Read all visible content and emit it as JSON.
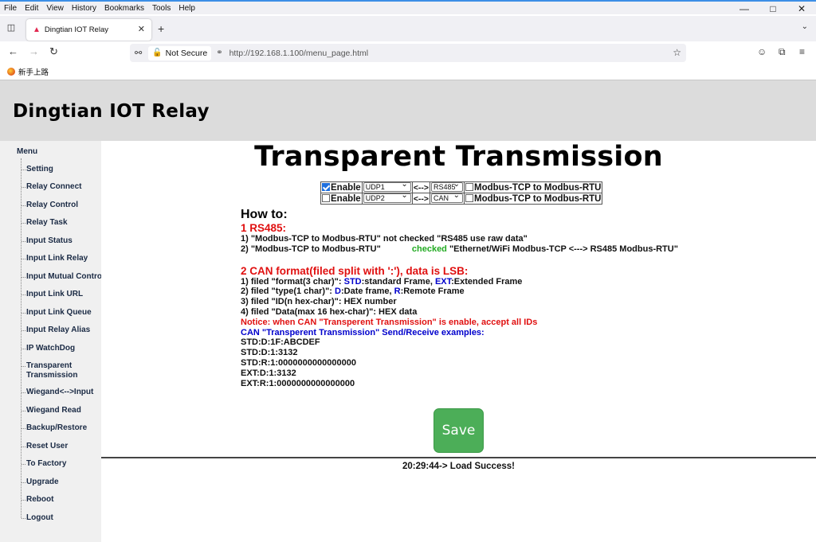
{
  "browser": {
    "menu": [
      "File",
      "Edit",
      "View",
      "History",
      "Bookmarks",
      "Tools",
      "Help"
    ],
    "tab_title": "Dingtian IOT Relay",
    "security_label": "Not Secure",
    "url": "http://192.168.1.100/menu_page.html",
    "bookmark": "新手上路"
  },
  "page": {
    "header_title": "Dingtian IOT Relay",
    "menu_title": "Menu",
    "sidebar": [
      "Setting",
      "Relay Connect",
      "Relay Control",
      "Relay Task",
      "Input Status",
      "Input Link Relay",
      "Input Mutual Control",
      "Input Link URL",
      "Input Link Queue",
      "Input Relay Alias",
      "IP WatchDog",
      "Transparent Transmission",
      "Wiegand<-->Input",
      "Wiegand Read",
      "Backup/Restore",
      "Reset User",
      "To Factory",
      "Upgrade",
      "Reboot",
      "Logout"
    ],
    "title": "Transparent Transmission",
    "rows": [
      {
        "enable_label": "Enable",
        "enabled": true,
        "proto": "UDP1",
        "arrow": "<-->",
        "port": "RS485",
        "mode_label": "Modbus-TCP to Modbus-RTU",
        "mode_checked": false
      },
      {
        "enable_label": "Enable",
        "enabled": false,
        "proto": "UDP2",
        "arrow": "<-->",
        "port": "CAN",
        "mode_label": "Modbus-TCP to Modbus-RTU",
        "mode_checked": false
      }
    ],
    "howto": {
      "heading": "How to:",
      "rs485_heading": "1 RS485:",
      "rs485_line1": "1) \"Modbus-TCP to Modbus-RTU\" not checked \"RS485 use raw data\"",
      "rs485_line2_a": "2) \"Modbus-TCP to Modbus-RTU\"",
      "rs485_line2_checked": "checked",
      "rs485_line2_b": "\"Ethernet/WiFi Modbus-TCP <---> RS485 Modbus-RTU\"",
      "can_heading": "2 CAN format(filed split with ':'), data is LSB:",
      "can1_a": "1) filed \"format(3 char)\": ",
      "can1_std": "STD",
      "can1_b": ":standard Frame, ",
      "can1_ext": "EXT",
      "can1_c": ":Extended Frame",
      "can2_a": "2) filed \"type(1 char)\": ",
      "can2_d": "D",
      "can2_b": ":Date frame, ",
      "can2_r": "R",
      "can2_c": ":Remote Frame",
      "can3": "3) filed \"ID(n hex-char)\": HEX number",
      "can4": "4) filed \"Data(max 16 hex-char)\": HEX data",
      "notice": "Notice: when CAN \"Transperent Transmission\" is enable, accept all IDs",
      "examples_heading": "CAN \"Transperent Transmission\" Send/Receive examples:",
      "examples": [
        "STD:D:1F:ABCDEF",
        "STD:D:1:3132",
        "STD:R:1:0000000000000000",
        "EXT:D:1:3132",
        "EXT:R:1:0000000000000000"
      ]
    },
    "save_label": "Save",
    "status": "20:29:44-> Load Success!"
  }
}
